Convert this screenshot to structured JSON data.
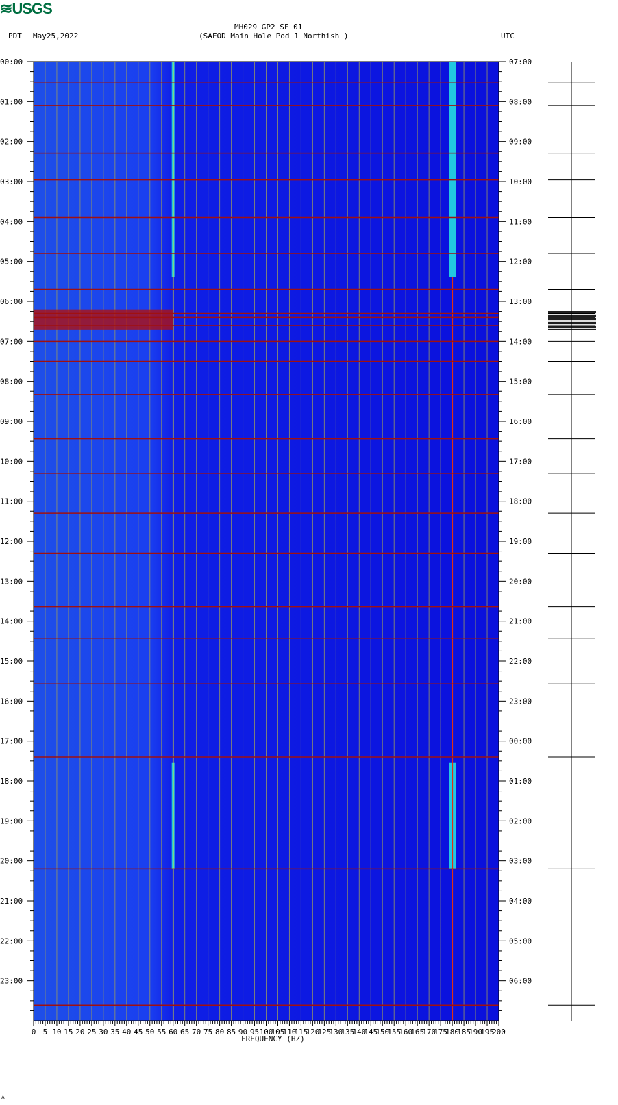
{
  "logo": "USGS",
  "header": {
    "title": "MH029 GP2 SF 01",
    "subtitle": "(SAFOD Main Hole Pod 1 Northish )",
    "left_tz": "PDT",
    "date": "May25,2022",
    "right_tz": "UTC"
  },
  "footer_mark": "ʌ",
  "chart_data": {
    "type": "heatmap",
    "title": "MH029 GP2 SF 01",
    "xlabel": "FREQUENCY (HZ)",
    "xlim": [
      0,
      200
    ],
    "x_ticks": [
      "0",
      "5",
      "10",
      "15",
      "20",
      "25",
      "30",
      "35",
      "40",
      "45",
      "50",
      "55",
      "60",
      "65",
      "70",
      "75",
      "80",
      "85",
      "90",
      "95",
      "100",
      "105",
      "110",
      "115",
      "120",
      "125",
      "130",
      "135",
      "140",
      "145",
      "150",
      "155",
      "160",
      "165",
      "170",
      "175",
      "180",
      "185",
      "190",
      "195",
      "200"
    ],
    "y_left_ticks": [
      "00:00",
      "01:00",
      "02:00",
      "03:00",
      "04:00",
      "05:00",
      "06:00",
      "07:00",
      "08:00",
      "09:00",
      "10:00",
      "11:00",
      "12:00",
      "13:00",
      "14:00",
      "15:00",
      "16:00",
      "17:00",
      "18:00",
      "19:00",
      "20:00",
      "21:00",
      "22:00",
      "23:00"
    ],
    "y_right_ticks": [
      "07:00",
      "08:00",
      "09:00",
      "10:00",
      "11:00",
      "12:00",
      "13:00",
      "14:00",
      "15:00",
      "16:00",
      "17:00",
      "18:00",
      "19:00",
      "20:00",
      "21:00",
      "22:00",
      "23:00",
      "00:00",
      "01:00",
      "02:00",
      "03:00",
      "04:00",
      "05:00",
      "06:00"
    ],
    "ylim_hours": [
      0,
      24
    ],
    "strong_lines_hz": [
      60,
      180
    ],
    "tonal_bands": [
      {
        "hz": 60,
        "hours": [
          0,
          5.4
        ]
      },
      {
        "hz": 180,
        "hours": [
          0,
          5.4
        ]
      },
      {
        "hz": 60,
        "hours": [
          17.55,
          20.2
        ]
      },
      {
        "hz": 180,
        "hours": [
          17.55,
          20.2
        ]
      }
    ],
    "event_hours": [
      0.51,
      1.1,
      2.29,
      2.96,
      3.9,
      4.8,
      5.7,
      6.3,
      6.4,
      6.6,
      7.0,
      7.5,
      8.33,
      9.44,
      10.3,
      11.3,
      12.3,
      13.64,
      14.43,
      15.57,
      17.4,
      20.2,
      23.61
    ]
  }
}
